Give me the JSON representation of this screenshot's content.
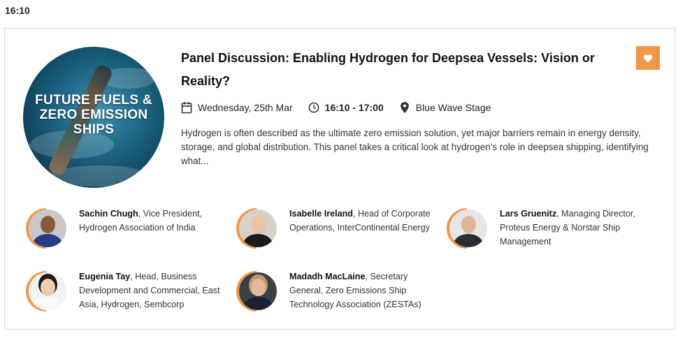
{
  "header": {
    "time": "16:10"
  },
  "session": {
    "thumbnail_text": "FUTURE FUELS & ZERO EMISSION SHIPS",
    "title": "Panel Discussion: Enabling Hydrogen for Deepsea Vessels: Vision or Reality?",
    "date": "Wednesday, 25th Mar",
    "time_range": "16:10 - 17:00",
    "location": "Blue Wave Stage",
    "description": "Hydrogen is often described as the ultimate zero emission solution, yet major barriers remain in energy density, storage, and global distribution. This panel takes a critical look at hydrogen’s role in deepsea shipping, identifying what...",
    "favorite_icon": "heart-icon"
  },
  "speakers": [
    {
      "name": "Sachin Chugh",
      "role": ", Vice President, Hydrogen Association of India"
    },
    {
      "name": "Isabelle Ireland",
      "role": ", Head of Corporate Operations, InterContinental Energy"
    },
    {
      "name": "Lars Gruenitz",
      "role": ", Managing Director, Proteus Energy & Norstar Ship Management"
    },
    {
      "name": "Eugenia Tay",
      "role": ", Head, Business Development and Commercial, East Asia, Hydrogen, Sembcorp"
    },
    {
      "name": "Madadh MacLaine",
      "role": ", Secretary General, Zero Emissions Ship Technology Association (ZESTAs)"
    }
  ],
  "colors": {
    "accent": "#f0974a"
  }
}
